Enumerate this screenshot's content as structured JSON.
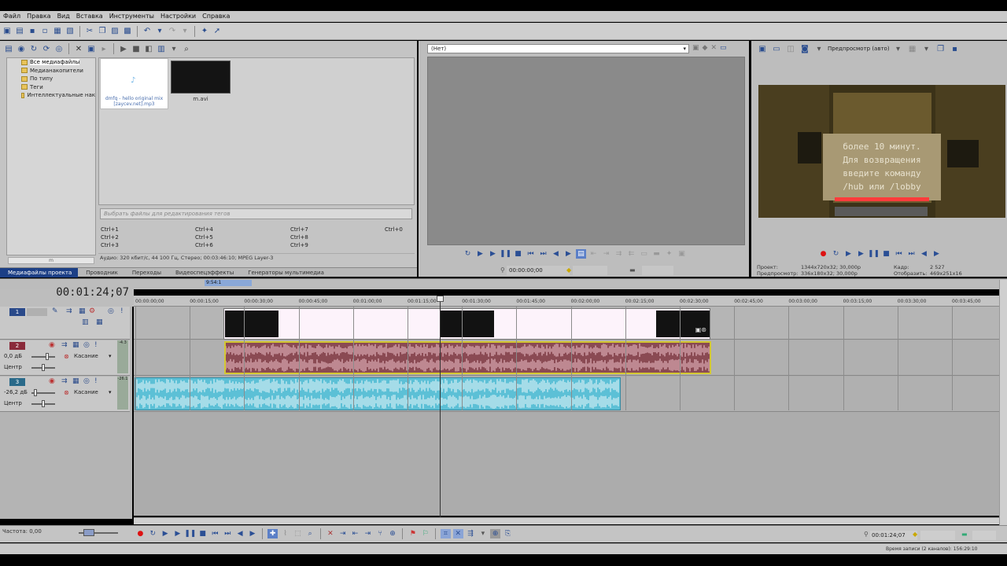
{
  "menu": [
    "Файл",
    "Правка",
    "Вид",
    "Вставка",
    "Инструменты",
    "Настройки",
    "Справка"
  ],
  "explorer": {
    "tree": [
      {
        "label": "Все медиафайлы",
        "selected": true
      },
      {
        "label": "Медианакопители",
        "selected": false
      },
      {
        "label": "По типу",
        "selected": false
      },
      {
        "label": "Теги",
        "selected": false
      },
      {
        "label": "Интеллектуальные нак",
        "selected": false
      }
    ],
    "tree_scroll_label": "m",
    "media": [
      {
        "caption": "dmfq - hello original mix [zaycev.net].mp3"
      },
      {
        "caption": "m.avi"
      }
    ],
    "tag_placeholder": "Выбрать файлы для редактирования тегов",
    "shortcuts": [
      "Ctrl+1",
      "Ctrl+2",
      "Ctrl+3",
      "Ctrl+4",
      "Ctrl+5",
      "Ctrl+6",
      "Ctrl+7",
      "Ctrl+8",
      "Ctrl+9",
      "Ctrl+0"
    ],
    "audio_info": "Аудио: 320 кбит/с, 44 100 Гц, Стерео; 00:03:46:10; MPEG Layer-3",
    "tabs": [
      {
        "label": "Медиафайлы проекта",
        "active": true
      },
      {
        "label": "Проводник",
        "active": false
      },
      {
        "label": "Переходы",
        "active": false
      },
      {
        "label": "Видеоспецэффекты",
        "active": false
      },
      {
        "label": "Генераторы мультимедиа",
        "active": false
      }
    ]
  },
  "trimmer": {
    "selector_value": "(Нет)",
    "time": "00:00:00;00"
  },
  "preview": {
    "mode_label": "Предпросмотр (авто)",
    "overlay_text": [
      "более 10 минут.",
      "Для возвращения",
      "введите команду",
      "/hub или /lobby"
    ],
    "info": {
      "project_label": "Проект:",
      "project_value": "1344x720x32; 30,000p",
      "preview_label": "Предпросмотр:",
      "preview_value": "336x180x32; 30,000p",
      "frame_label": "Кадр:",
      "frame_value": "2 527",
      "display_label": "Отобразить:",
      "display_value": "469x251x16"
    }
  },
  "timeline": {
    "current_time": "00:01:24;07",
    "ruler_ticks": [
      "00:00:00;00",
      "00:00:15;00",
      "00:00:30;00",
      "00:00:45;00",
      "00:01:00;00",
      "00:01:15;00",
      "00:01:30;00",
      "00:01:45;00",
      "00:02:00;00",
      "00:02:15;00",
      "00:02:30;00",
      "00:02:45;00",
      "00:03:00;00",
      "00:03:15;00",
      "00:03:30;00",
      "00:03:45;00"
    ],
    "marker_label": "9:54:1",
    "tracks": [
      {
        "number": "1",
        "type": "video"
      },
      {
        "number": "2",
        "type": "audio",
        "volume": "0,0 дБ",
        "pan": "Центр",
        "mode": "Касание",
        "meter": "-4.3"
      },
      {
        "number": "3",
        "type": "audio",
        "volume": "-26,2 дБ",
        "pan": "Центр",
        "mode": "Касание",
        "meter": "-26.1"
      }
    ],
    "rate_label": "Частота: 0,00",
    "end_time": "00:01:24;07",
    "status": "Время записи (2 каналов): 156:29:10"
  },
  "colors": {
    "accent": "#1c3f86",
    "audio_clip": "#8a4a53",
    "audio_clip2": "#5cc0d6",
    "selection": "#d4c832"
  }
}
